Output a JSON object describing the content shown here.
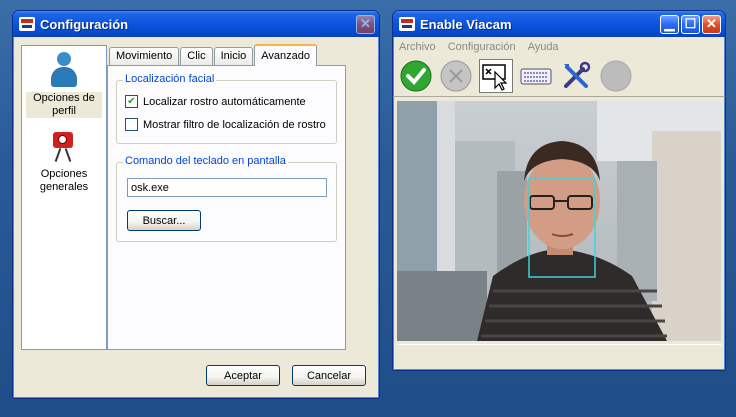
{
  "config_window": {
    "title": "Configuración",
    "close_icon": "close-icon",
    "sidebar": [
      {
        "label": "Opciones de perfil",
        "icon": "person-icon",
        "selected": true
      },
      {
        "label": "Opciones generales",
        "icon": "camera-icon",
        "selected": false
      }
    ],
    "tabs": [
      "Movimiento",
      "Clic",
      "Inicio",
      "Avanzado"
    ],
    "active_tab": "Avanzado",
    "face_group": {
      "legend": "Localización facial",
      "checkbox1_label": "Localizar rostro automáticamente",
      "checkbox1_checked": true,
      "checkbox2_label": "Mostrar filtro de localización de rostro",
      "checkbox2_checked": false
    },
    "keyboard_group": {
      "legend": "Comando del teclado en pantalla",
      "command_value": "osk.exe",
      "browse_label": "Buscar..."
    },
    "accept_label": "Aceptar",
    "cancel_label": "Cancelar"
  },
  "viacam_window": {
    "title": "Enable Viacam",
    "menu": [
      "Archivo",
      "Configuración",
      "Ayuda"
    ],
    "toolbar": [
      {
        "icon": "check-icon",
        "active": true
      },
      {
        "icon": "click-disabled-icon",
        "active": false
      },
      {
        "icon": "dwell-click-icon",
        "active": true
      },
      {
        "icon": "keyboard-icon",
        "active": true
      },
      {
        "icon": "tools-icon",
        "active": true
      },
      {
        "icon": "gray-circle-icon",
        "active": false
      }
    ],
    "colors": {
      "accent_green": "#2fa82f",
      "face_box": "#3fd3d8"
    }
  }
}
